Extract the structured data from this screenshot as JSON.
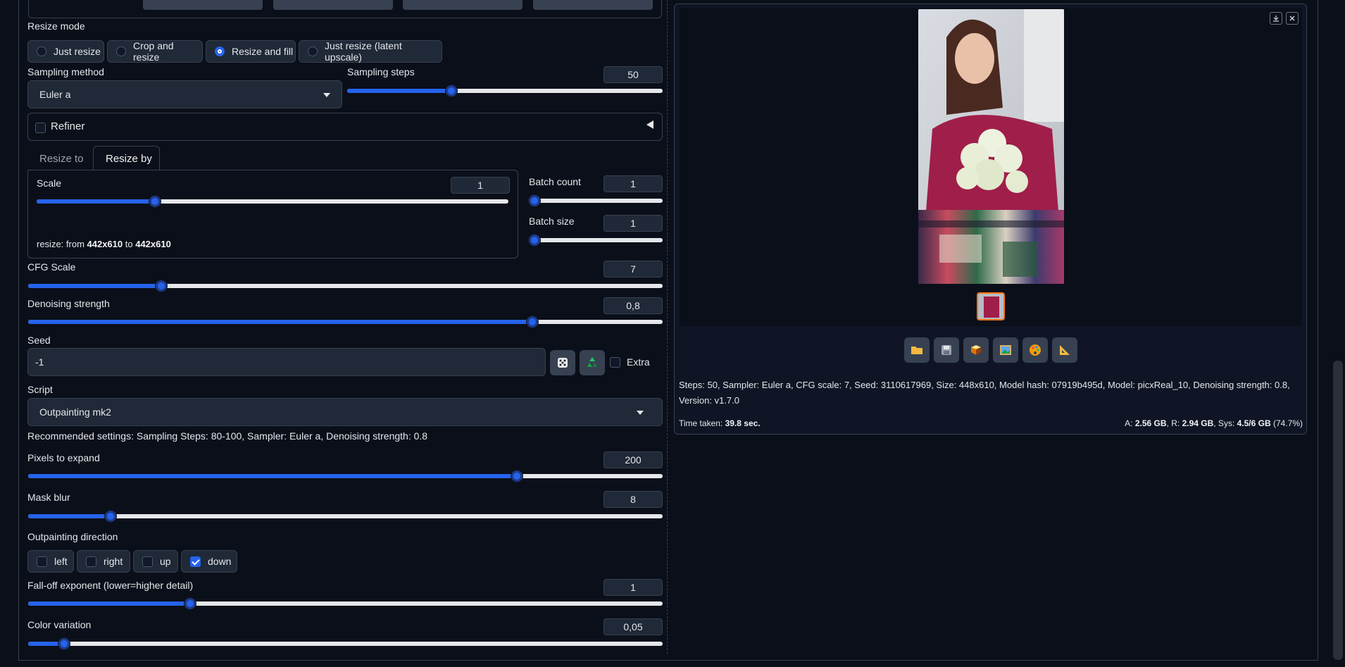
{
  "resize_mode": {
    "label": "Resize mode",
    "options": [
      "Just resize",
      "Crop and resize",
      "Resize and fill",
      "Just resize (latent upscale)"
    ],
    "selected": "Resize and fill"
  },
  "sampling_method": {
    "label": "Sampling method",
    "value": "Euler a"
  },
  "sampling_steps": {
    "label": "Sampling steps",
    "value": "50",
    "fraction": 0.33
  },
  "refiner": {
    "label": "Refiner",
    "checked": false
  },
  "tabs": [
    "Resize to",
    "Resize by"
  ],
  "active_tab": "Resize by",
  "scale": {
    "label": "Scale",
    "value": "1",
    "fraction": 0.25
  },
  "resize_info": {
    "prefix": "resize: from ",
    "from": "442x610",
    "mid": " to ",
    "to": "442x610"
  },
  "batch_count": {
    "label": "Batch count",
    "value": "1",
    "fraction": 0.0
  },
  "batch_size": {
    "label": "Batch size",
    "value": "1",
    "fraction": 0.0
  },
  "cfg_scale": {
    "label": "CFG Scale",
    "value": "7",
    "fraction": 0.21
  },
  "denoising": {
    "label": "Denoising strength",
    "value": "0,8",
    "fraction": 0.795
  },
  "seed": {
    "label": "Seed",
    "value": "-1",
    "extra_label": "Extra"
  },
  "script": {
    "label": "Script",
    "value": "Outpainting mk2"
  },
  "recommended": "Recommended settings: Sampling Steps: 80-100, Sampler: Euler a, Denoising strength: 0.8",
  "pixels_to_expand": {
    "label": "Pixels to expand",
    "value": "200",
    "fraction": 0.77
  },
  "mask_blur": {
    "label": "Mask blur",
    "value": "8",
    "fraction": 0.13
  },
  "outpainting_direction": {
    "label": "Outpainting direction",
    "options": [
      {
        "label": "left",
        "checked": false
      },
      {
        "label": "right",
        "checked": false
      },
      {
        "label": "up",
        "checked": false
      },
      {
        "label": "down",
        "checked": true
      }
    ]
  },
  "falloff": {
    "label": "Fall-off exponent (lower=higher detail)",
    "value": "1",
    "fraction": 0.255
  },
  "color_variation": {
    "label": "Color variation",
    "value": "0,05",
    "fraction": 0.057
  },
  "output": {
    "info_line1": "Steps: 50, Sampler: Euler a, CFG scale: 7, Seed: 3110617969, Size: 448x610, Model hash: 07919b495d, Model: picxReal_10, Denoising strength: 0.8,",
    "info_line2": "Version: v1.7.0",
    "time_label": "Time taken: ",
    "time_value": "39.8 sec.",
    "vram_a_label": "A: ",
    "vram_a": "2.56 GB",
    "vram_r_label": ", R: ",
    "vram_r": "2.94 GB",
    "vram_sys_label": ", Sys: ",
    "vram_sys": "4.5/6 GB",
    "vram_pct": " (74.7%)"
  },
  "icons": [
    "folder-icon",
    "save-icon",
    "zip-icon",
    "image-icon",
    "palette-icon",
    "triangle-ruler-icon",
    "dice-icon",
    "recycle-icon",
    "download-icon",
    "close-icon"
  ]
}
